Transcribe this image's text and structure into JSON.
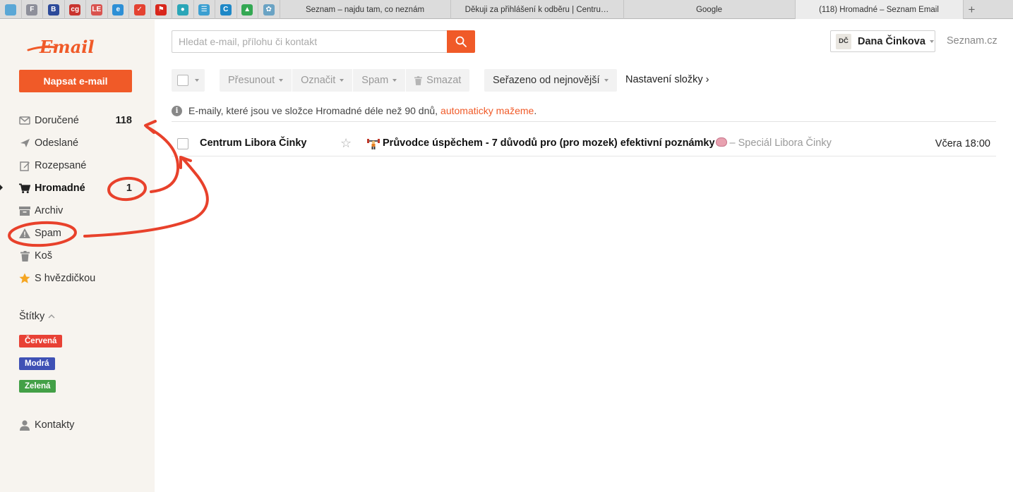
{
  "browser": {
    "pinned_tabs": [
      {
        "icon": "box-icon",
        "glyph": "",
        "color": "#5aa7d6"
      },
      {
        "icon": "f-icon",
        "glyph": "F",
        "color": "#8d8f9a"
      },
      {
        "icon": "b-icon",
        "glyph": "B",
        "color": "#2c4a9a"
      },
      {
        "icon": "cg-icon",
        "glyph": "cg",
        "color": "#c9342f"
      },
      {
        "icon": "le-icon",
        "glyph": "LE",
        "color": "#d9534f"
      },
      {
        "icon": "e-icon",
        "glyph": "e",
        "color": "#2d8fd6"
      },
      {
        "icon": "todoist-icon",
        "glyph": "✓",
        "color": "#e44232"
      },
      {
        "icon": "flag-icon",
        "glyph": "⚑",
        "color": "#d8261c"
      },
      {
        "icon": "head-icon",
        "glyph": "●",
        "color": "#2ba6b8"
      },
      {
        "icon": "list-icon",
        "glyph": "☰",
        "color": "#3b9fd1"
      },
      {
        "icon": "c-icon",
        "glyph": "C",
        "color": "#1e88c7"
      },
      {
        "icon": "drive-icon",
        "glyph": "▲",
        "color": "#34a853"
      },
      {
        "icon": "globe-icon",
        "glyph": "✿",
        "color": "#6aa3c4"
      }
    ],
    "tabs": [
      {
        "title": "Seznam – najdu tam, co neznám",
        "active": false
      },
      {
        "title": "Děkuji za přihlášení k odběru | Centru…",
        "active": false
      },
      {
        "title": "Google",
        "active": false
      },
      {
        "title": "(118) Hromadné – Seznam Email",
        "active": true
      }
    ],
    "new_tab": "+"
  },
  "sidebar": {
    "logo_text": "Email",
    "compose_label": "Napsat e-mail",
    "folders": [
      {
        "label": "Doručené",
        "count": "118",
        "icon": "inbox-icon",
        "active": false
      },
      {
        "label": "Odeslané",
        "count": "",
        "icon": "sent-icon",
        "active": false
      },
      {
        "label": "Rozepsané",
        "count": "",
        "icon": "drafts-icon",
        "active": false
      },
      {
        "label": "Hromadné",
        "count": "1",
        "icon": "cart-icon",
        "active": true
      },
      {
        "label": "Archiv",
        "count": "",
        "icon": "archive-icon",
        "active": false
      },
      {
        "label": "Spam",
        "count": "",
        "icon": "warning-icon",
        "active": false
      },
      {
        "label": "Koš",
        "count": "",
        "icon": "trash-icon",
        "active": false
      },
      {
        "label": "S hvězdičkou",
        "count": "",
        "icon": "star-icon",
        "active": false
      }
    ],
    "tags_heading": "Štítky",
    "tags": [
      {
        "label": "Červená",
        "color": "#e84135"
      },
      {
        "label": "Modrá",
        "color": "#3f51b5"
      },
      {
        "label": "Zelená",
        "color": "#43a047"
      }
    ],
    "contacts_label": "Kontakty"
  },
  "header": {
    "search_placeholder": "Hledat e-mail, přílohu či kontakt",
    "user_initials": "DČ",
    "user_name": "Dana Činkova",
    "seznam_link": "Seznam.cz"
  },
  "toolbar": {
    "move_label": "Přesunout",
    "mark_label": "Označit",
    "spam_label": "Spam",
    "delete_label": "Smazat",
    "sort_label": "Seřazeno od nejnovější",
    "folder_settings_label": "Nastavení složky ›"
  },
  "notice": {
    "text": "E-maily, které jsou ve složce Hromadné déle než 90 dnů,",
    "link": "automaticky mažeme",
    "end": "."
  },
  "messages": [
    {
      "sender": "Centrum Libora Činky",
      "subject": "Průvodce úspěchem - 7 důvodů pro (pro mozek) efektivní poznámky",
      "preview": "– Speciál Libora Činky",
      "date": "Včera 18:00"
    }
  ],
  "colors": {
    "brand": "#f05a28",
    "annotation": "#e8412b"
  }
}
